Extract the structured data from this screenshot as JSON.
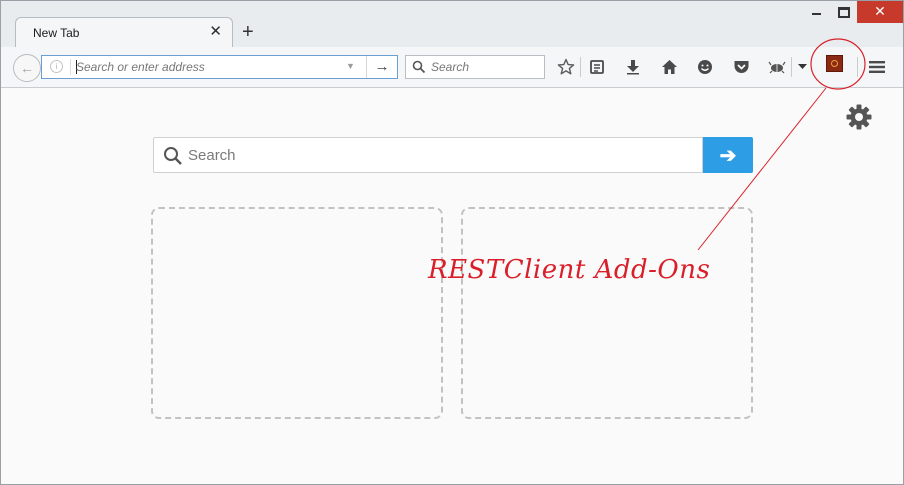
{
  "tab": {
    "title": "New Tab",
    "close_glyph": "✕"
  },
  "window_controls": {
    "close_glyph": "✕"
  },
  "navbar": {
    "url_placeholder": "Search or enter address",
    "search_placeholder": "Search"
  },
  "content": {
    "search_placeholder": "Search"
  },
  "annotation": {
    "text": "RESTClient Add-Ons",
    "color": "#d9202a"
  }
}
